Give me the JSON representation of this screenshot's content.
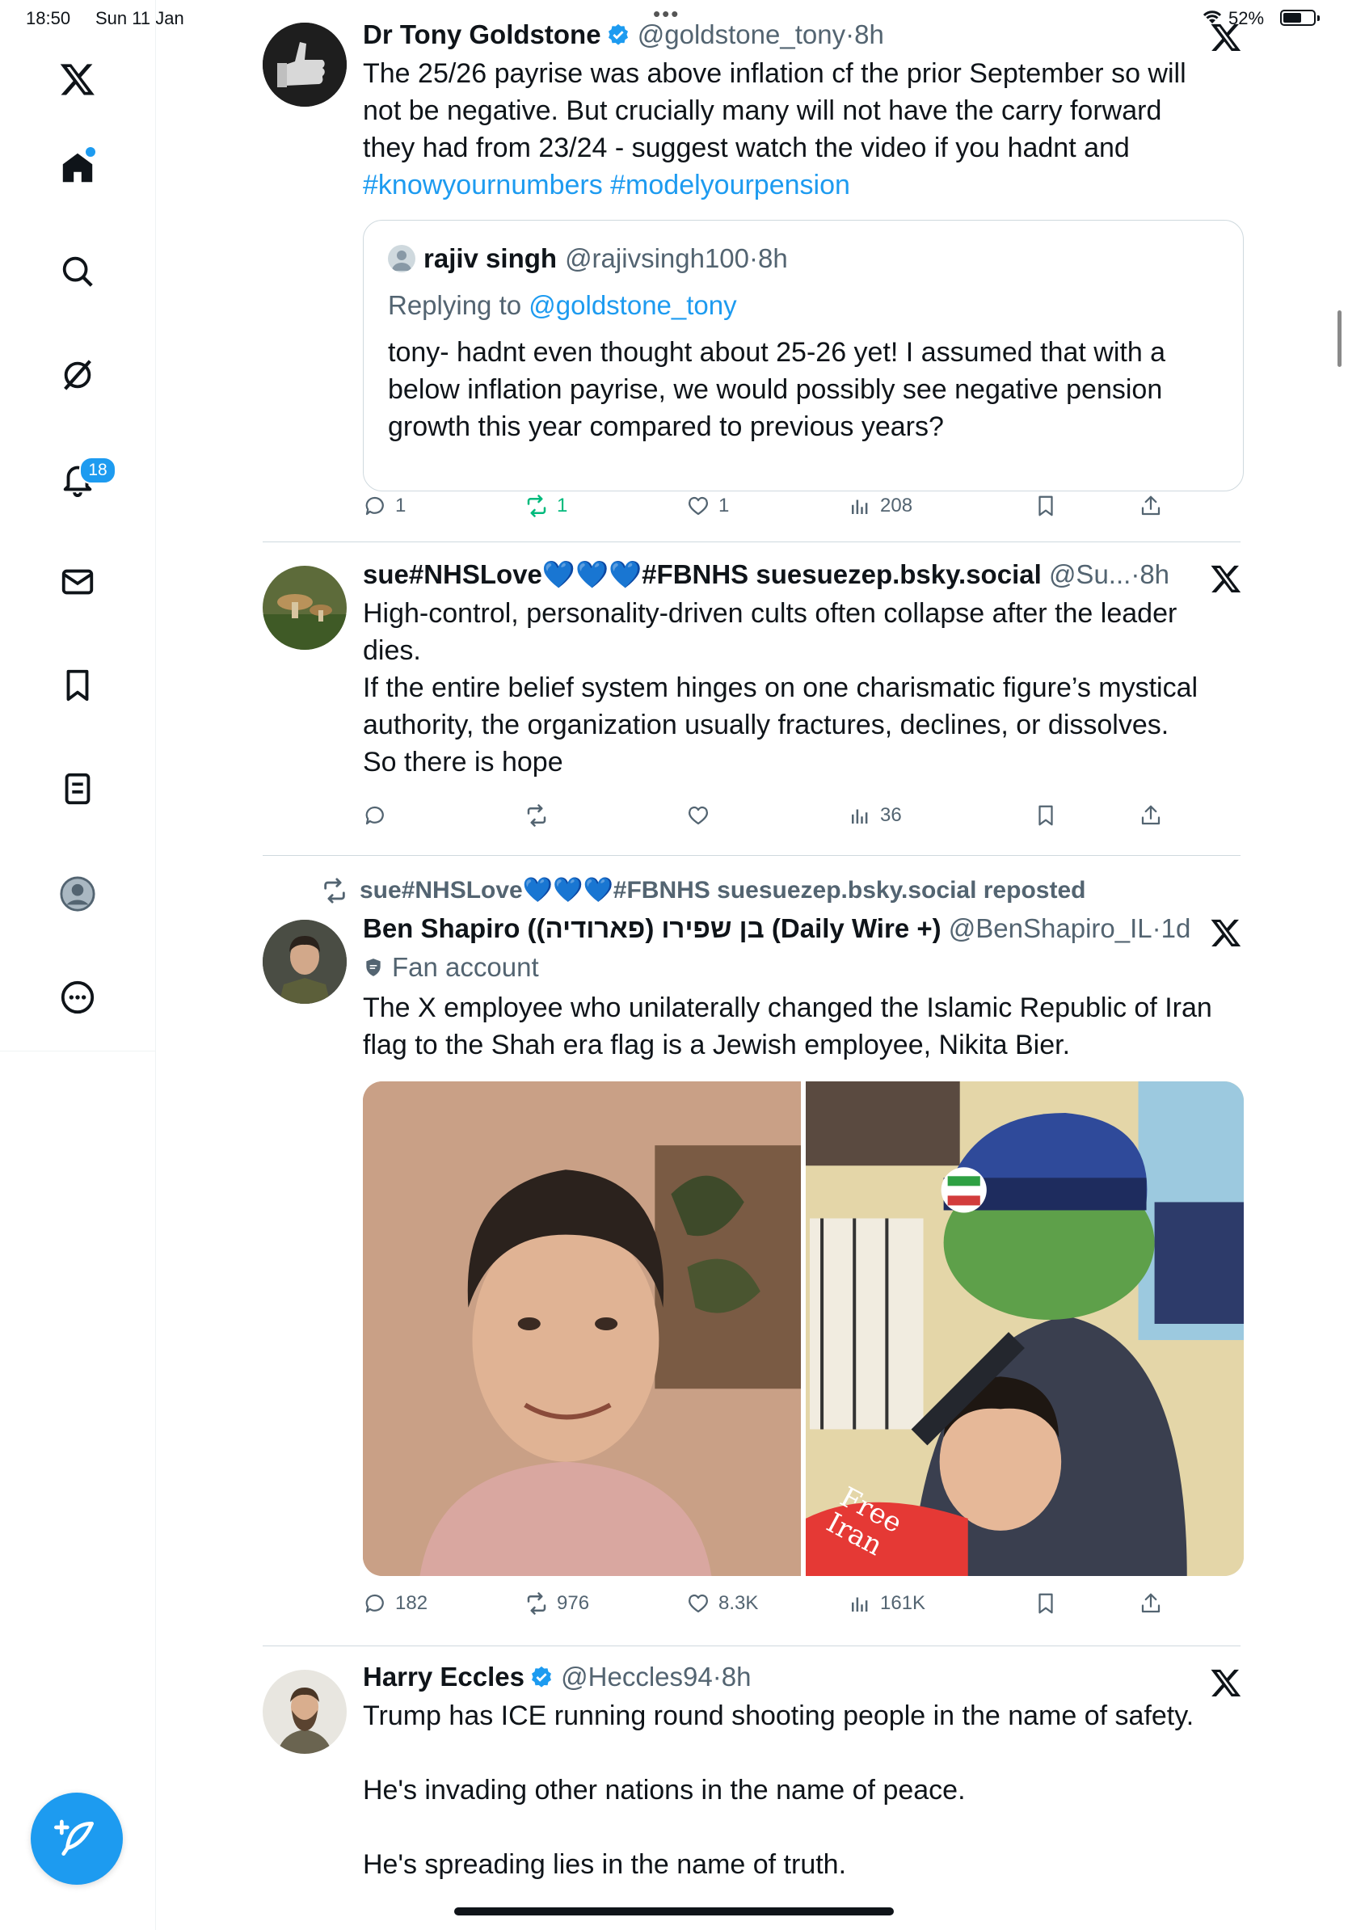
{
  "status_bar": {
    "time": "18:50",
    "date": "Sun 11 Jan",
    "battery": "52%"
  },
  "sidebar": {
    "notifications_badge": "18",
    "items": [
      "x-logo",
      "home",
      "search",
      "grok",
      "notifications",
      "messages",
      "bookmarks",
      "lists",
      "profile",
      "more"
    ]
  },
  "tweets": [
    {
      "name": "Dr Tony Goldstone",
      "handle": "@goldstone_tony",
      "time": "8h",
      "text": "The 25/26 payrise was above inflation cf the prior September so will not be negative. But crucially many will not have the carry forward they had from 23/24 - suggest watch the video if you hadnt and",
      "hashtags": "#knowyournumbers #modelyourpension",
      "quote": {
        "name": "rajiv singh",
        "handle": "@rajivsingh100",
        "time": "8h",
        "replying_prefix": "Replying to",
        "replying_handle": "@goldstone_tony",
        "text": "tony- hadnt even thought about 25-26 yet! I assumed that with a below inflation payrise, we would possibly see negative pension growth this year compared to previous years?"
      },
      "replies": "1",
      "reposts": "1",
      "likes": "1",
      "views": "208"
    },
    {
      "name": "sue#NHSLove💙💙💙#FBNHS suesuezep.bsky.social",
      "handle": "@Su...",
      "time": "8h",
      "lines": [
        "High-control, personality-driven cults often collapse after the leader dies.",
        "If the entire belief system hinges on one charismatic figure’s mystical authority, the organization usually fractures, declines, or dissolves.",
        "So there is hope"
      ],
      "replies": "",
      "reposts": "",
      "likes": "",
      "views": "36"
    },
    {
      "reposted_by": "sue#NHSLove💙💙💙#FBNHS suesuezep.bsky.social reposted",
      "name": "Ben Shapiro (בן שפירו (פארודיה) (Daily Wire +)",
      "handle": "@BenShapiro_IL",
      "time": "1d",
      "fan_label": "Fan account",
      "text": "The X employee who unilaterally changed the Islamic Republic of Iran flag to the Shah era flag is a Jewish employee, Nikita Bier.",
      "image_caption": "Free Iran",
      "replies": "182",
      "reposts": "976",
      "likes": "8.3K",
      "views": "161K"
    },
    {
      "name": "Harry Eccles",
      "handle": "@Heccles94",
      "time": "8h",
      "lines": [
        "Trump has ICE running round shooting people in the name of safety.",
        "He's invading other nations in the name of peace.",
        "He's spreading lies in the name of truth."
      ]
    }
  ],
  "colors": {
    "accent": "#1d9bf0",
    "repost_active": "#00ba7c",
    "muted": "#536471",
    "text": "#0f1419"
  }
}
